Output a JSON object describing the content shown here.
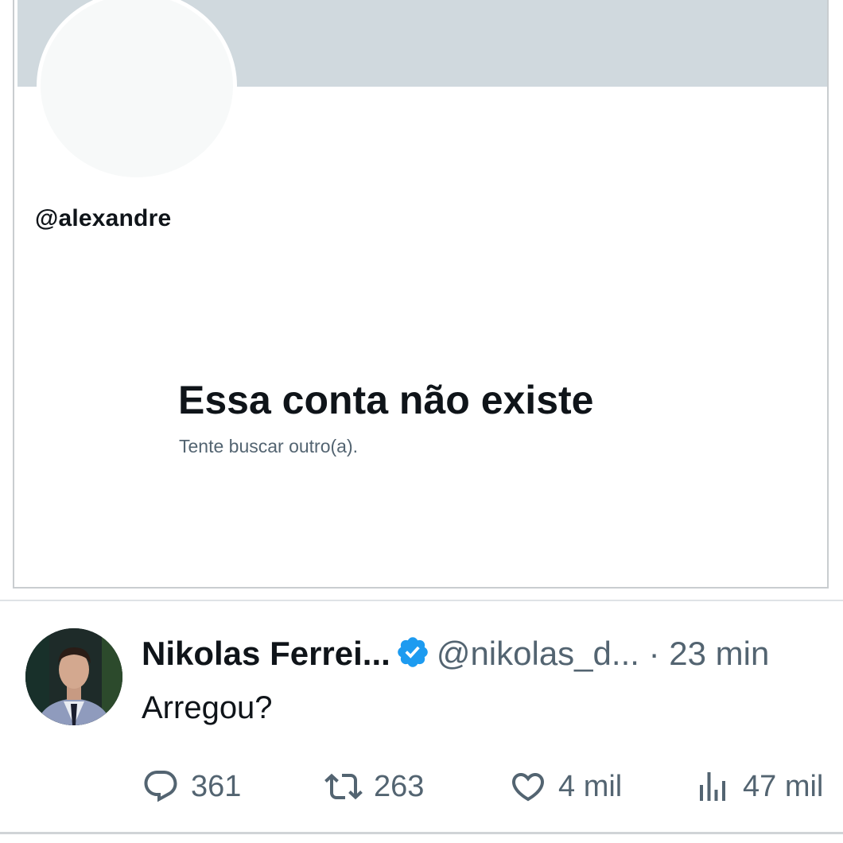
{
  "profile": {
    "handle": "@alexandre",
    "empty_state": {
      "title": "Essa conta não existe",
      "subtitle": "Tente buscar outro(a)."
    }
  },
  "tweet": {
    "display_name": "Nikolas Ferrei...",
    "verified": true,
    "handle": "@nikolas_d...",
    "separator": "·",
    "time": "23 min",
    "text": "Arregou?",
    "actions": {
      "replies": "361",
      "retweets": "263",
      "likes": "4 mil",
      "views": "47 mil"
    }
  },
  "colors": {
    "banner": "#d0d9de",
    "verified_blue": "#1d9bf0",
    "primary_text": "#0f1419",
    "secondary_text": "#536471"
  },
  "icons": {
    "reply": "reply-icon",
    "retweet": "retweet-icon",
    "like": "heart-icon",
    "views": "views-chart-icon",
    "verified": "verified-badge-icon"
  }
}
